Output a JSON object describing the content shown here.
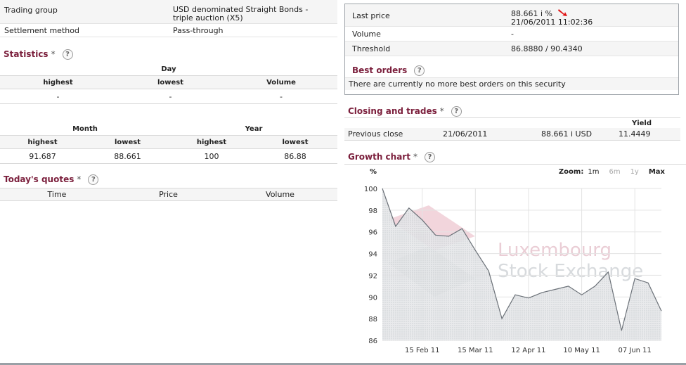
{
  "left": {
    "trading_group_label": "Trading group",
    "trading_group_value_line1": "USD denominated Straight Bonds -",
    "trading_group_value_line2": "triple auction (X5)",
    "settlement_label": "Settlement method",
    "settlement_value": "Pass-through",
    "statistics_title": "Statistics",
    "star": "*",
    "help": "?",
    "day_label": "Day",
    "day_headers": [
      "highest",
      "lowest",
      "Volume"
    ],
    "day_values": [
      "-",
      "-",
      "-"
    ],
    "month_label": "Month",
    "year_label": "Year",
    "my_headers": [
      "highest",
      "lowest",
      "highest",
      "lowest"
    ],
    "my_values": [
      "91.687",
      "88.661",
      "100",
      "86.88"
    ],
    "quotes_title": "Today's quotes",
    "quotes_headers": [
      "Time",
      "Price",
      "Volume"
    ]
  },
  "right": {
    "last_price_label": "Last price",
    "last_price_value": "88.661 i  %",
    "last_price_time": "21/06/2011 11:02:36",
    "volume_label": "Volume",
    "volume_value": "-",
    "threshold_label": "Threshold",
    "threshold_value": "86.8880 / 90.4340",
    "best_orders_title": "Best orders",
    "best_orders_text": "There are currently no more best orders on this security",
    "closing_title": "Closing and trades",
    "yield_header": "Yield",
    "prev_close_label": "Previous close",
    "prev_close_date": "21/06/2011",
    "prev_close_price": "88.661 i USD",
    "prev_close_yield": "11.4449",
    "growth_title": "Growth chart",
    "zoom_label": "Zoom:",
    "zoom_options": [
      "1m",
      "6m",
      "1y",
      "Max"
    ],
    "watermark_line1": "Luxembourg",
    "watermark_line2": "Stock Exchange",
    "colors": {
      "title": "#7b1f3c",
      "arrow": "#e01010",
      "line": "#6b7178",
      "fill": "#d7dadd"
    }
  },
  "chart_data": {
    "type": "area",
    "ylabel": "%",
    "ylim": [
      86,
      100
    ],
    "yticks": [
      86,
      88,
      90,
      92,
      94,
      96,
      98,
      100
    ],
    "xticks": [
      "15 Feb 11",
      "15 Mar 11",
      "12 Apr 11",
      "10 May 11",
      "07 Jun 11"
    ],
    "xtick_index": [
      3,
      7,
      11,
      15,
      19
    ],
    "values": [
      100,
      96.5,
      98.2,
      97.1,
      95.7,
      95.6,
      96.3,
      94.3,
      92.4,
      88.0,
      90.2,
      89.9,
      90.4,
      90.7,
      91.0,
      90.2,
      91.0,
      92.3,
      86.9,
      91.7,
      91.3,
      88.7
    ]
  }
}
